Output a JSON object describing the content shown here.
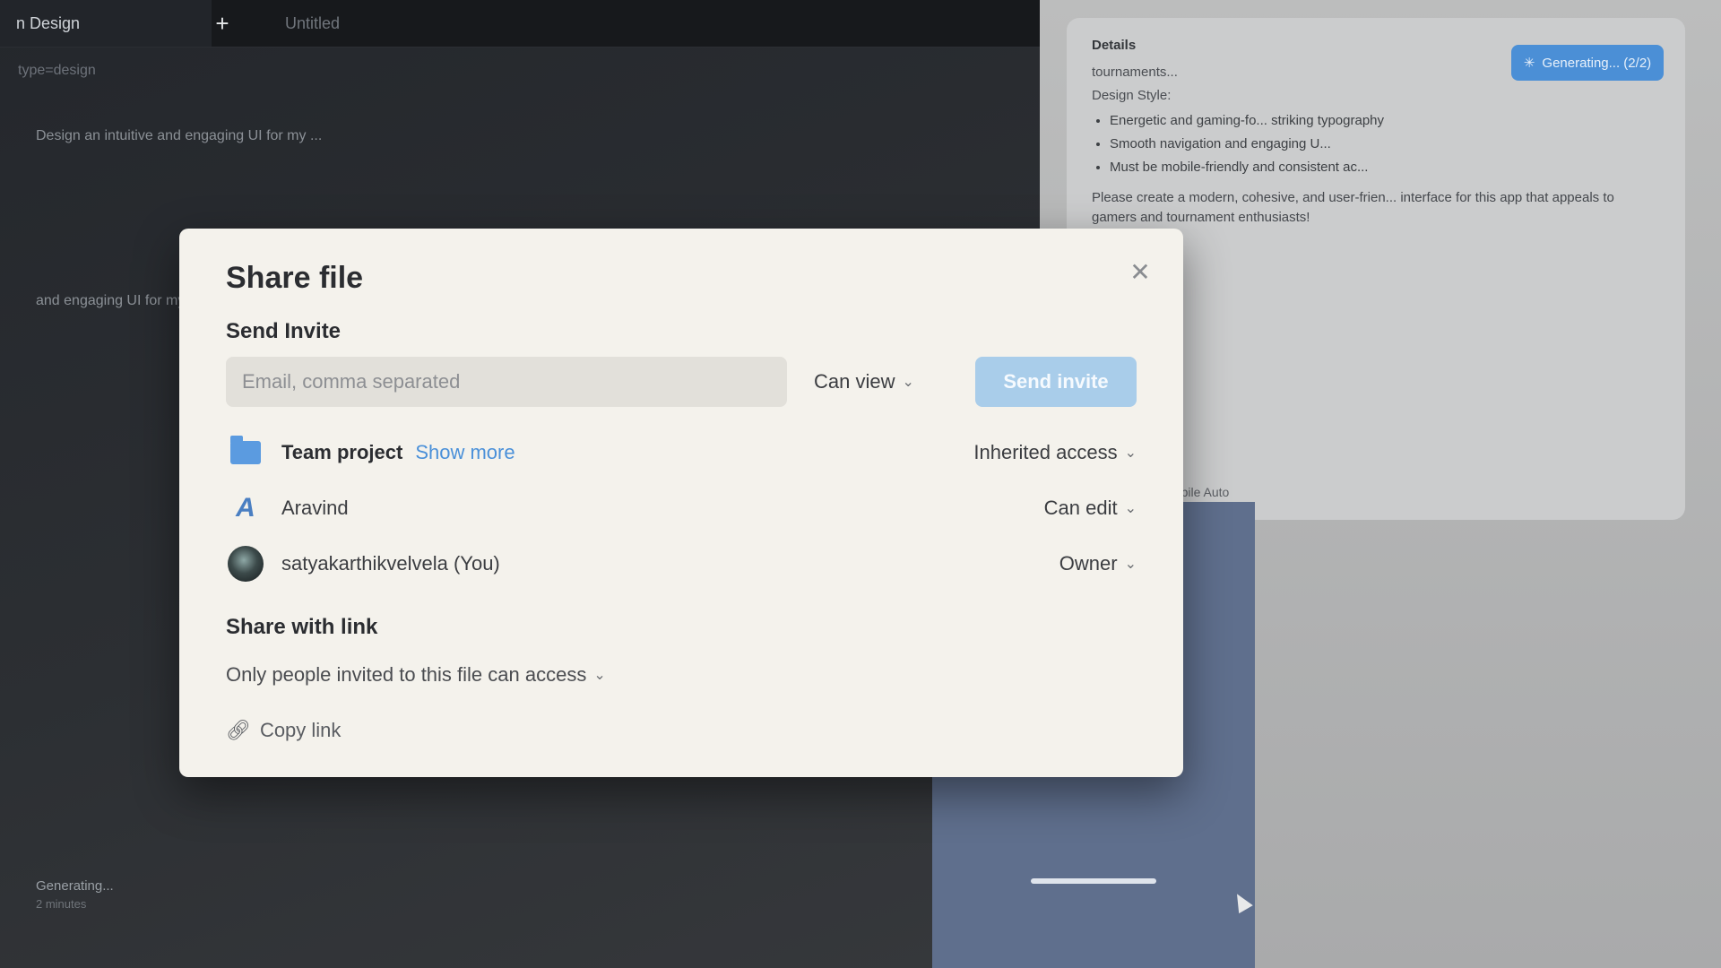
{
  "app": {
    "active_tab": "n Design",
    "new_tab": "+",
    "untitled_tab": "Untitled",
    "breadcrumb": "type=design",
    "prompt_preview": "Design an intuitive and engaging UI for my ...",
    "left_prompt": "and engaging UI for my ...",
    "generating": "Generating...",
    "generating_time": "2 minutes"
  },
  "side_panel": {
    "details_header": "Details",
    "details_text": "tournaments...",
    "design_style_label": "Design Style:",
    "bullets": [
      "Energetic and gaming-fo... striking typography",
      "Smooth navigation and engaging U...",
      "Must be mobile-friendly and consistent ac..."
    ],
    "request": "Please create a modern, cohesive, and user-frien... interface for this app that appeals to gamers and tournament enthusiasts!",
    "mode_label": "Mobile Auto",
    "generating_button": "Generating... (2/2)"
  },
  "modal": {
    "title": "Share file",
    "close": "✕",
    "send_invite_label": "Send Invite",
    "email_placeholder": "Email, comma separated",
    "permission": "Can view",
    "send_button": "Send invite",
    "members": [
      {
        "name": "Team project",
        "extra": "Show more",
        "access": "Inherited access"
      },
      {
        "name": "Aravind",
        "access": "Can edit"
      },
      {
        "name": "satyakarthikvelvela (You)",
        "access": "Owner"
      }
    ],
    "share_with_link_label": "Share with link",
    "link_access": "Only people invited to this file can access",
    "copy_link": "Copy link"
  },
  "icons": {
    "chevron": "chevron-down-icon",
    "folder": "folder-icon",
    "link": "link-icon",
    "close": "close-icon"
  }
}
